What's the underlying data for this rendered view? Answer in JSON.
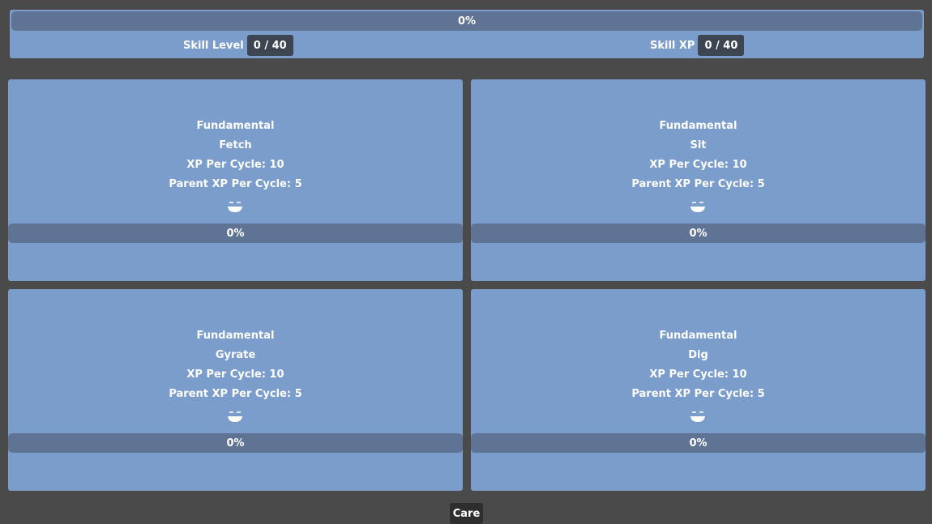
{
  "skill": {
    "progress_text": "0%",
    "progress": 0,
    "level_label": "Skill Level",
    "level_value": "0 / 40",
    "xp_label": "Skill XP",
    "xp_value": "0 / 40"
  },
  "tricks": [
    {
      "category": "Fundamental",
      "name": "Fetch",
      "xp_per_cycle": "XP Per Cycle: 10",
      "parent_xp_per_cycle": "Parent XP Per Cycle: 5",
      "icon": "bowl-face-icon",
      "progress_text": "0%",
      "progress": 0
    },
    {
      "category": "Fundamental",
      "name": "Sit",
      "xp_per_cycle": "XP Per Cycle: 10",
      "parent_xp_per_cycle": "Parent XP Per Cycle: 5",
      "icon": "bowl-face-icon",
      "progress_text": "0%",
      "progress": 0
    },
    {
      "category": "Fundamental",
      "name": "Gyrate",
      "xp_per_cycle": "XP Per Cycle: 10",
      "parent_xp_per_cycle": "Parent XP Per Cycle: 5",
      "icon": "bowl-face-icon",
      "progress_text": "0%",
      "progress": 0
    },
    {
      "category": "Fundamental",
      "name": "Dig",
      "xp_per_cycle": "XP Per Cycle: 10",
      "parent_xp_per_cycle": "Parent XP Per Cycle: 5",
      "icon": "bowl-face-icon",
      "progress_text": "0%",
      "progress": 0
    }
  ],
  "footer": {
    "care_label": "Care"
  },
  "colors": {
    "background": "#4a4a4a",
    "panel": "#7b9dcb",
    "bar": "#5f7394",
    "value_box": "#3e4552"
  }
}
